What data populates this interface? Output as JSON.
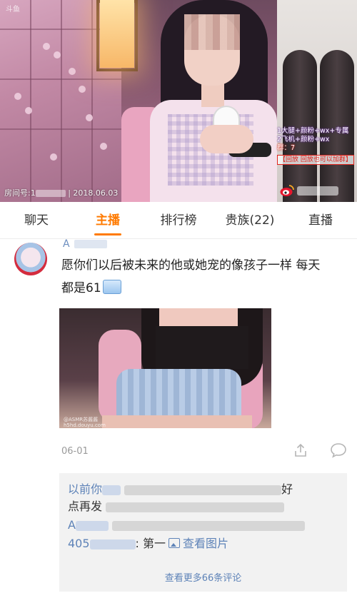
{
  "video": {
    "watermark": "斗鱼",
    "room_label": "房间号:1",
    "date": "2018.06.03",
    "overlay_lines": [
      "1大腿+颜粉+wx+专属",
      "2飞机+颜粉+wx",
      "群：7"
    ],
    "overlay_tag": "【回放 回放也可以加群】"
  },
  "tabs": [
    {
      "label": "聊天"
    },
    {
      "label": "主播"
    },
    {
      "label": "排行榜"
    },
    {
      "label": "贵族(22)"
    },
    {
      "label": "直播"
    }
  ],
  "active_tab": "主播",
  "post": {
    "username": "A",
    "text_line1": "愿你们以后被未来的他或她宠的像孩子一样 每天",
    "text_line2": "都是61",
    "image_watermark": "@ASMR苏酱酱\nh5hd.douyu.com",
    "date": "06-01"
  },
  "comments": {
    "line1_user": "以前你",
    "line1_end": "好",
    "line2_text": "点再发",
    "line3_user": "A",
    "line4_user": "405",
    "line4_text": ": 第一",
    "view_image": "查看图片",
    "more": "查看更多66条评论"
  },
  "colors": {
    "accent": "#ff7a00",
    "link": "#5e83b8",
    "text": "#222222",
    "muted": "#9a9a9a"
  },
  "icons": [
    "weibo-icon",
    "share-icon",
    "comment-icon",
    "image-icon"
  ]
}
